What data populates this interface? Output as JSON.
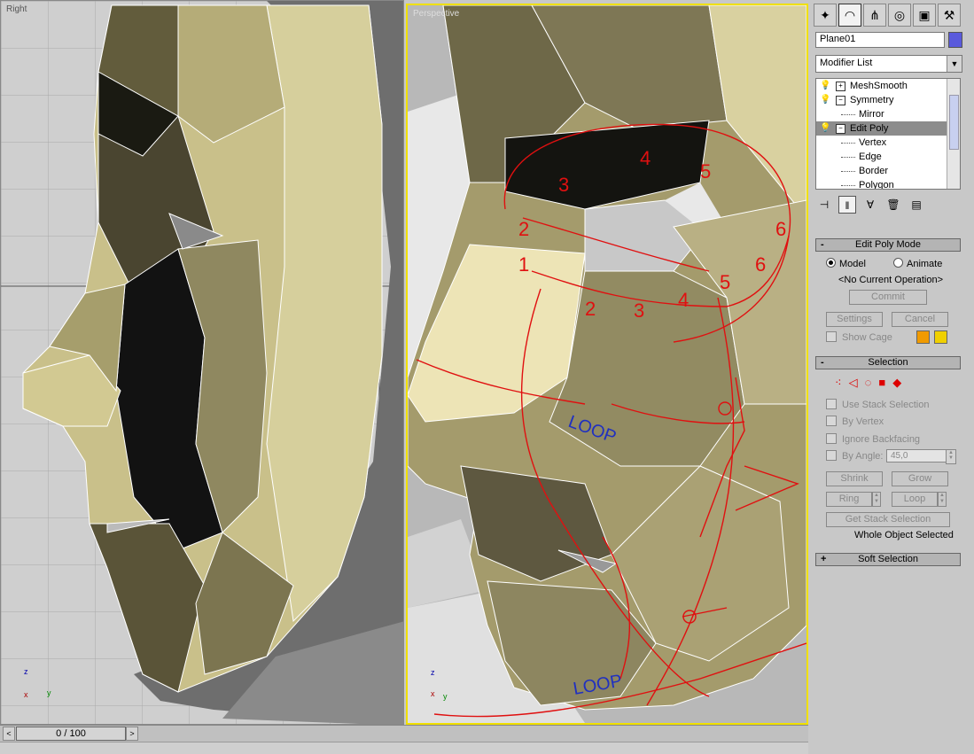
{
  "viewports": {
    "left_label": "Right",
    "right_label": "Perspective"
  },
  "annotations": {
    "loop1": "LOOP",
    "loop2": "LOOP",
    "numbers_top": [
      "1",
      "2",
      "3",
      "4",
      "5",
      "6"
    ],
    "numbers_bottom": [
      "1",
      "2",
      "3",
      "4",
      "5",
      "6"
    ]
  },
  "axis": {
    "z": "z",
    "x": "x",
    "y": "y"
  },
  "panel": {
    "tabs": [
      "create-tab",
      "modify-tab",
      "hierarchy-tab",
      "motion-tab",
      "display-tab",
      "utilities-tab"
    ],
    "object_name": "Plane01",
    "object_color": "#5a5adc",
    "modifier_list": "Modifier List",
    "stack": [
      {
        "label": "MeshSmooth",
        "sign": "+",
        "sub": false,
        "selected": false
      },
      {
        "label": "Symmetry",
        "sign": "−",
        "sub": false,
        "selected": false
      },
      {
        "label": "Mirror",
        "sign": "",
        "sub": true,
        "selected": false
      },
      {
        "label": "Edit Poly",
        "sign": "−",
        "sub": false,
        "selected": true
      },
      {
        "label": "Vertex",
        "sign": "",
        "sub": true,
        "selected": false
      },
      {
        "label": "Edge",
        "sign": "",
        "sub": true,
        "selected": false
      },
      {
        "label": "Border",
        "sign": "",
        "sub": true,
        "selected": false
      },
      {
        "label": "Polygon",
        "sign": "",
        "sub": true,
        "selected": false
      }
    ],
    "edit_poly_mode": {
      "title": "Edit Poly Mode",
      "model": "Model",
      "animate": "Animate",
      "current_op": "<No Current Operation>",
      "commit": "Commit",
      "settings": "Settings",
      "cancel": "Cancel",
      "show_cage": "Show Cage",
      "cage_color_1": "#f09a00",
      "cage_color_2": "#f0d000"
    },
    "selection": {
      "title": "Selection",
      "use_stack": "Use Stack Selection",
      "by_vertex": "By Vertex",
      "ignore_backfacing": "Ignore Backfacing",
      "by_angle": "By Angle:",
      "angle_value": "45,0",
      "shrink": "Shrink",
      "grow": "Grow",
      "ring": "Ring",
      "loop": "Loop",
      "get_stack": "Get Stack Selection",
      "status": "Whole Object Selected"
    },
    "soft_selection": {
      "title": "Soft Selection"
    }
  },
  "timeline": {
    "frame": "0 / 100"
  }
}
